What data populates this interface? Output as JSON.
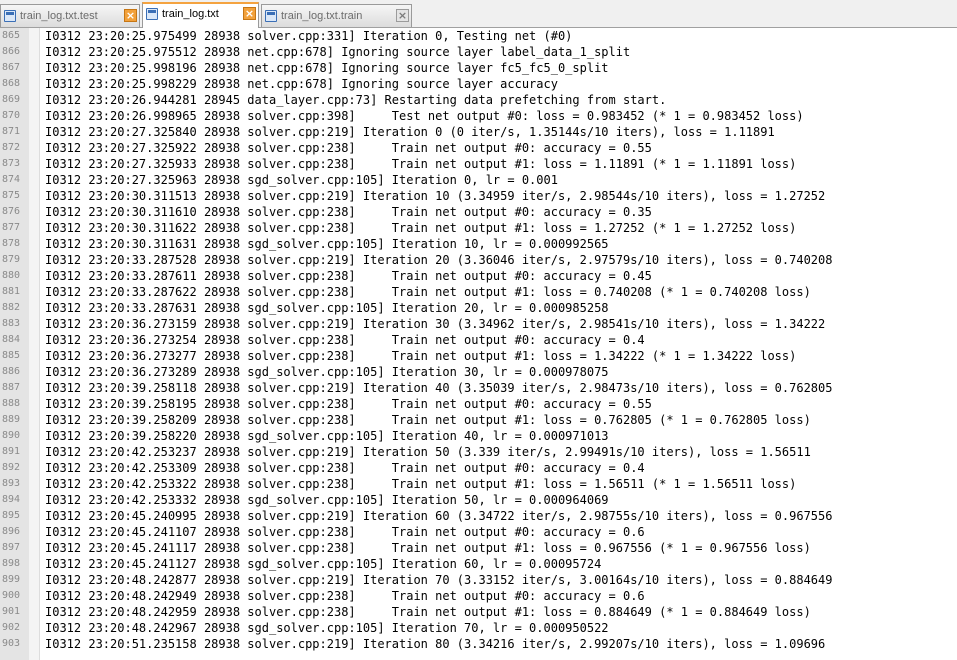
{
  "tabs": [
    {
      "label": "train_log.txt.test",
      "active": false
    },
    {
      "label": "train_log.txt",
      "active": true
    },
    {
      "label": "train_log.txt.train",
      "active": false
    }
  ],
  "colors": {
    "accent": "#f4a340",
    "gutter": "#e4e4e4",
    "close_button": "#f2a13b"
  },
  "icons": {
    "file": "document-icon",
    "close": "close-icon"
  },
  "editor": {
    "lines": [
      {
        "num": "865",
        "text": "I0312 23:20:25.975499 28938 solver.cpp:331] Iteration 0, Testing net (#0)"
      },
      {
        "num": "866",
        "text": "I0312 23:20:25.975512 28938 net.cpp:678] Ignoring source layer label_data_1_split"
      },
      {
        "num": "867",
        "text": "I0312 23:20:25.998196 28938 net.cpp:678] Ignoring source layer fc5_fc5_0_split"
      },
      {
        "num": "868",
        "text": "I0312 23:20:25.998229 28938 net.cpp:678] Ignoring source layer accuracy"
      },
      {
        "num": "869",
        "text": "I0312 23:20:26.944281 28945 data_layer.cpp:73] Restarting data prefetching from start."
      },
      {
        "num": "870",
        "text": "I0312 23:20:26.998965 28938 solver.cpp:398]     Test net output #0: loss = 0.983452 (* 1 = 0.983452 loss)"
      },
      {
        "num": "871",
        "text": "I0312 23:20:27.325840 28938 solver.cpp:219] Iteration 0 (0 iter/s, 1.35144s/10 iters), loss = 1.11891"
      },
      {
        "num": "872",
        "text": "I0312 23:20:27.325922 28938 solver.cpp:238]     Train net output #0: accuracy = 0.55"
      },
      {
        "num": "873",
        "text": "I0312 23:20:27.325933 28938 solver.cpp:238]     Train net output #1: loss = 1.11891 (* 1 = 1.11891 loss)"
      },
      {
        "num": "874",
        "text": "I0312 23:20:27.325963 28938 sgd_solver.cpp:105] Iteration 0, lr = 0.001"
      },
      {
        "num": "875",
        "text": "I0312 23:20:30.311513 28938 solver.cpp:219] Iteration 10 (3.34959 iter/s, 2.98544s/10 iters), loss = 1.27252"
      },
      {
        "num": "876",
        "text": "I0312 23:20:30.311610 28938 solver.cpp:238]     Train net output #0: accuracy = 0.35"
      },
      {
        "num": "877",
        "text": "I0312 23:20:30.311622 28938 solver.cpp:238]     Train net output #1: loss = 1.27252 (* 1 = 1.27252 loss)"
      },
      {
        "num": "878",
        "text": "I0312 23:20:30.311631 28938 sgd_solver.cpp:105] Iteration 10, lr = 0.000992565"
      },
      {
        "num": "879",
        "text": "I0312 23:20:33.287528 28938 solver.cpp:219] Iteration 20 (3.36046 iter/s, 2.97579s/10 iters), loss = 0.740208"
      },
      {
        "num": "880",
        "text": "I0312 23:20:33.287611 28938 solver.cpp:238]     Train net output #0: accuracy = 0.45"
      },
      {
        "num": "881",
        "text": "I0312 23:20:33.287622 28938 solver.cpp:238]     Train net output #1: loss = 0.740208 (* 1 = 0.740208 loss)"
      },
      {
        "num": "882",
        "text": "I0312 23:20:33.287631 28938 sgd_solver.cpp:105] Iteration 20, lr = 0.000985258"
      },
      {
        "num": "883",
        "text": "I0312 23:20:36.273159 28938 solver.cpp:219] Iteration 30 (3.34962 iter/s, 2.98541s/10 iters), loss = 1.34222"
      },
      {
        "num": "884",
        "text": "I0312 23:20:36.273254 28938 solver.cpp:238]     Train net output #0: accuracy = 0.4"
      },
      {
        "num": "885",
        "text": "I0312 23:20:36.273277 28938 solver.cpp:238]     Train net output #1: loss = 1.34222 (* 1 = 1.34222 loss)"
      },
      {
        "num": "886",
        "text": "I0312 23:20:36.273289 28938 sgd_solver.cpp:105] Iteration 30, lr = 0.000978075"
      },
      {
        "num": "887",
        "text": "I0312 23:20:39.258118 28938 solver.cpp:219] Iteration 40 (3.35039 iter/s, 2.98473s/10 iters), loss = 0.762805"
      },
      {
        "num": "888",
        "text": "I0312 23:20:39.258195 28938 solver.cpp:238]     Train net output #0: accuracy = 0.55"
      },
      {
        "num": "889",
        "text": "I0312 23:20:39.258209 28938 solver.cpp:238]     Train net output #1: loss = 0.762805 (* 1 = 0.762805 loss)"
      },
      {
        "num": "890",
        "text": "I0312 23:20:39.258220 28938 sgd_solver.cpp:105] Iteration 40, lr = 0.000971013"
      },
      {
        "num": "891",
        "text": "I0312 23:20:42.253237 28938 solver.cpp:219] Iteration 50 (3.339 iter/s, 2.99491s/10 iters), loss = 1.56511"
      },
      {
        "num": "892",
        "text": "I0312 23:20:42.253309 28938 solver.cpp:238]     Train net output #0: accuracy = 0.4"
      },
      {
        "num": "893",
        "text": "I0312 23:20:42.253322 28938 solver.cpp:238]     Train net output #1: loss = 1.56511 (* 1 = 1.56511 loss)"
      },
      {
        "num": "894",
        "text": "I0312 23:20:42.253332 28938 sgd_solver.cpp:105] Iteration 50, lr = 0.000964069"
      },
      {
        "num": "895",
        "text": "I0312 23:20:45.240995 28938 solver.cpp:219] Iteration 60 (3.34722 iter/s, 2.98755s/10 iters), loss = 0.967556"
      },
      {
        "num": "896",
        "text": "I0312 23:20:45.241107 28938 solver.cpp:238]     Train net output #0: accuracy = 0.6"
      },
      {
        "num": "897",
        "text": "I0312 23:20:45.241117 28938 solver.cpp:238]     Train net output #1: loss = 0.967556 (* 1 = 0.967556 loss)"
      },
      {
        "num": "898",
        "text": "I0312 23:20:45.241127 28938 sgd_solver.cpp:105] Iteration 60, lr = 0.00095724"
      },
      {
        "num": "899",
        "text": "I0312 23:20:48.242877 28938 solver.cpp:219] Iteration 70 (3.33152 iter/s, 3.00164s/10 iters), loss = 0.884649"
      },
      {
        "num": "900",
        "text": "I0312 23:20:48.242949 28938 solver.cpp:238]     Train net output #0: accuracy = 0.6"
      },
      {
        "num": "901",
        "text": "I0312 23:20:48.242959 28938 solver.cpp:238]     Train net output #1: loss = 0.884649 (* 1 = 0.884649 loss)"
      },
      {
        "num": "902",
        "text": "I0312 23:20:48.242967 28938 sgd_solver.cpp:105] Iteration 70, lr = 0.000950522"
      },
      {
        "num": "903",
        "text": "I0312 23:20:51.235158 28938 solver.cpp:219] Iteration 80 (3.34216 iter/s, 2.99207s/10 iters), loss = 1.09696"
      }
    ]
  }
}
